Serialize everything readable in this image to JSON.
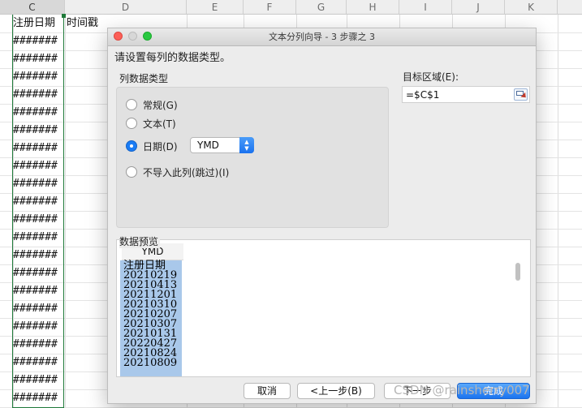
{
  "sheet": {
    "columns": [
      "C",
      "D",
      "E",
      "F",
      "G",
      "H",
      "I",
      "J",
      "K"
    ],
    "header_cell": "注册日期",
    "next_cell": "时间戳",
    "overflow_value": "#######"
  },
  "dialog": {
    "title": "文本分列向导 - 3 步骤之 3",
    "instruction": "请设置每列的数据类型。",
    "group_title": "列数据类型",
    "options": [
      {
        "label": "常规(G)",
        "selected": false
      },
      {
        "label": "文本(T)",
        "selected": false
      },
      {
        "label": "日期(D)",
        "selected": true
      },
      {
        "label": "不导入此列(跳过)(I)",
        "selected": false
      }
    ],
    "date_format": "YMD",
    "destination_label": "目标区域(E):",
    "destination_value": "=$C$1",
    "preview_label": "数据预览",
    "preview_header": "YMD",
    "preview_rows": [
      "注册日期",
      "20210219",
      "20210413",
      "20211201",
      "20210310",
      "20210207",
      "20210307",
      "20210131",
      "20220427",
      "20210824",
      "20210809"
    ],
    "buttons": {
      "cancel": "取消",
      "back": "<上一步(B)",
      "next": "下一步",
      "finish": "完成"
    }
  },
  "watermark": "CSDN @rainsherry007",
  "colors": {
    "accent": "#1a7cf5",
    "selection_green": "#1f7a3a",
    "preview_selection": "#a9c8ea"
  }
}
